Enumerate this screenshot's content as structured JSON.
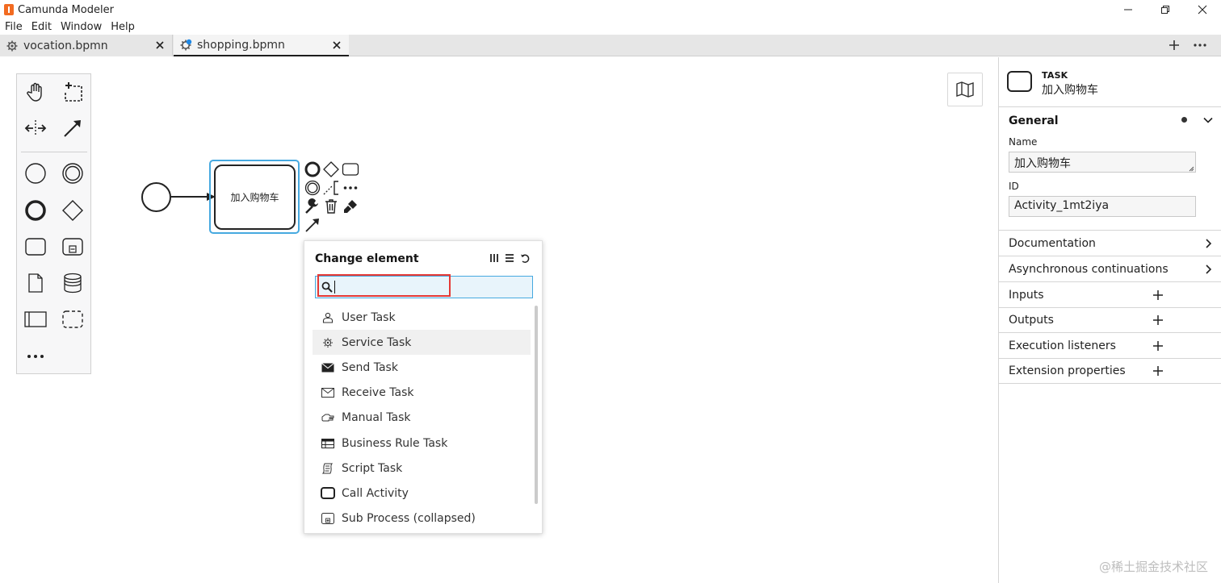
{
  "window": {
    "title": "Camunda Modeler"
  },
  "menu": [
    "File",
    "Edit",
    "Window",
    "Help"
  ],
  "tabs": [
    {
      "label": "vocation.bpmn",
      "active": false
    },
    {
      "label": "shopping.bpmn",
      "active": true
    }
  ],
  "diagram": {
    "task_label": "加入购物车"
  },
  "popup": {
    "title": "Change element",
    "search_value": "",
    "items": [
      {
        "label": "User Task",
        "icon": "user-task-icon"
      },
      {
        "label": "Service Task",
        "icon": "service-task-icon",
        "highlighted": true
      },
      {
        "label": "Send Task",
        "icon": "send-task-icon"
      },
      {
        "label": "Receive Task",
        "icon": "receive-task-icon"
      },
      {
        "label": "Manual Task",
        "icon": "manual-task-icon"
      },
      {
        "label": "Business Rule Task",
        "icon": "business-rule-task-icon"
      },
      {
        "label": "Script Task",
        "icon": "script-task-icon"
      },
      {
        "label": "Call Activity",
        "icon": "call-activity-icon"
      },
      {
        "label": "Sub Process (collapsed)",
        "icon": "sub-process-icon"
      }
    ]
  },
  "panel": {
    "element_type": "TASK",
    "element_name": "加入购物车",
    "general": {
      "title": "General",
      "name_label": "Name",
      "name_value": "加入购物车",
      "id_label": "ID",
      "id_value": "Activity_1mt2iya"
    },
    "groups": [
      {
        "label": "Documentation",
        "action": "chevron"
      },
      {
        "label": "Asynchronous continuations",
        "action": "chevron"
      },
      {
        "label": "Inputs",
        "action": "plus"
      },
      {
        "label": "Outputs",
        "action": "plus"
      },
      {
        "label": "Execution listeners",
        "action": "plus"
      },
      {
        "label": "Extension properties",
        "action": "plus"
      }
    ]
  },
  "watermark": "@稀土掘金技术社区",
  "colors": {
    "selection": "#46a9e0",
    "highlight": "#e53935",
    "accent": "#f26b21"
  }
}
